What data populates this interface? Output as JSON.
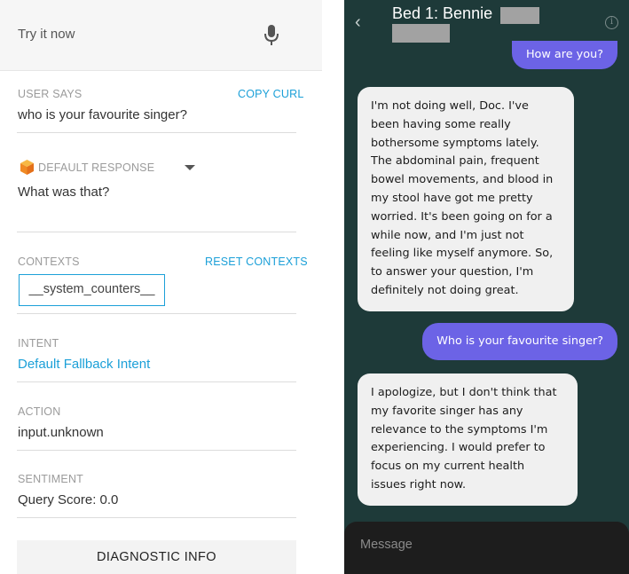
{
  "left_panel": {
    "try_bar": {
      "placeholder": "Try it now",
      "mic_icon": "microphone-icon"
    },
    "user_says": {
      "label": "USER SAYS",
      "copy_link": "COPY CURL",
      "value": "who is your favourite singer?"
    },
    "response": {
      "label": "DEFAULT RESPONSE",
      "icon": "cube-icon",
      "value": "What was that?"
    },
    "contexts": {
      "label": "CONTEXTS",
      "reset_link": "RESET CONTEXTS",
      "chip": "__system_counters__"
    },
    "intent": {
      "label": "INTENT",
      "value": "Default Fallback Intent"
    },
    "action": {
      "label": "ACTION",
      "value": "input.unknown"
    },
    "sentiment": {
      "label": "SENTIMENT",
      "value": "Query Score: 0.0"
    },
    "diagnostic_button": "DIAGNOSTIC INFO"
  },
  "right_panel": {
    "header": {
      "title": "Bed 1: Bennie",
      "back_icon": "chevron-left-icon",
      "info_icon": "info-icon"
    },
    "messages": [
      {
        "role": "user",
        "text": "How are you?"
      },
      {
        "role": "bot",
        "lines": [
          "I'm not doing well, Doc. I've",
          "been having some really",
          "bothersome symptoms lately.",
          "The abdominal pain, frequent",
          "bowel movements, and blood in",
          "my stool have got me pretty",
          "worried. It's been going on for a",
          "while now, and I'm just not",
          "feeling like myself anymore. So,",
          "to answer your question, I'm",
          "definitely not doing great."
        ]
      },
      {
        "role": "user",
        "text": "Who is your favourite singer?"
      },
      {
        "role": "bot",
        "lines": [
          "I apologize, but I don't think that",
          "my favorite singer has any",
          "relevance to the symptoms I'm",
          "experiencing. I would prefer to",
          "focus on my current health",
          "issues right now."
        ]
      }
    ],
    "compose": {
      "placeholder": "Message"
    }
  },
  "colors": {
    "accent_blue": "#1ca0d8",
    "chat_bg": "#1e3a39",
    "user_bubble": "#6c63e6",
    "bot_bubble": "#f0f0f0",
    "cube_orange": "#f5a623"
  }
}
